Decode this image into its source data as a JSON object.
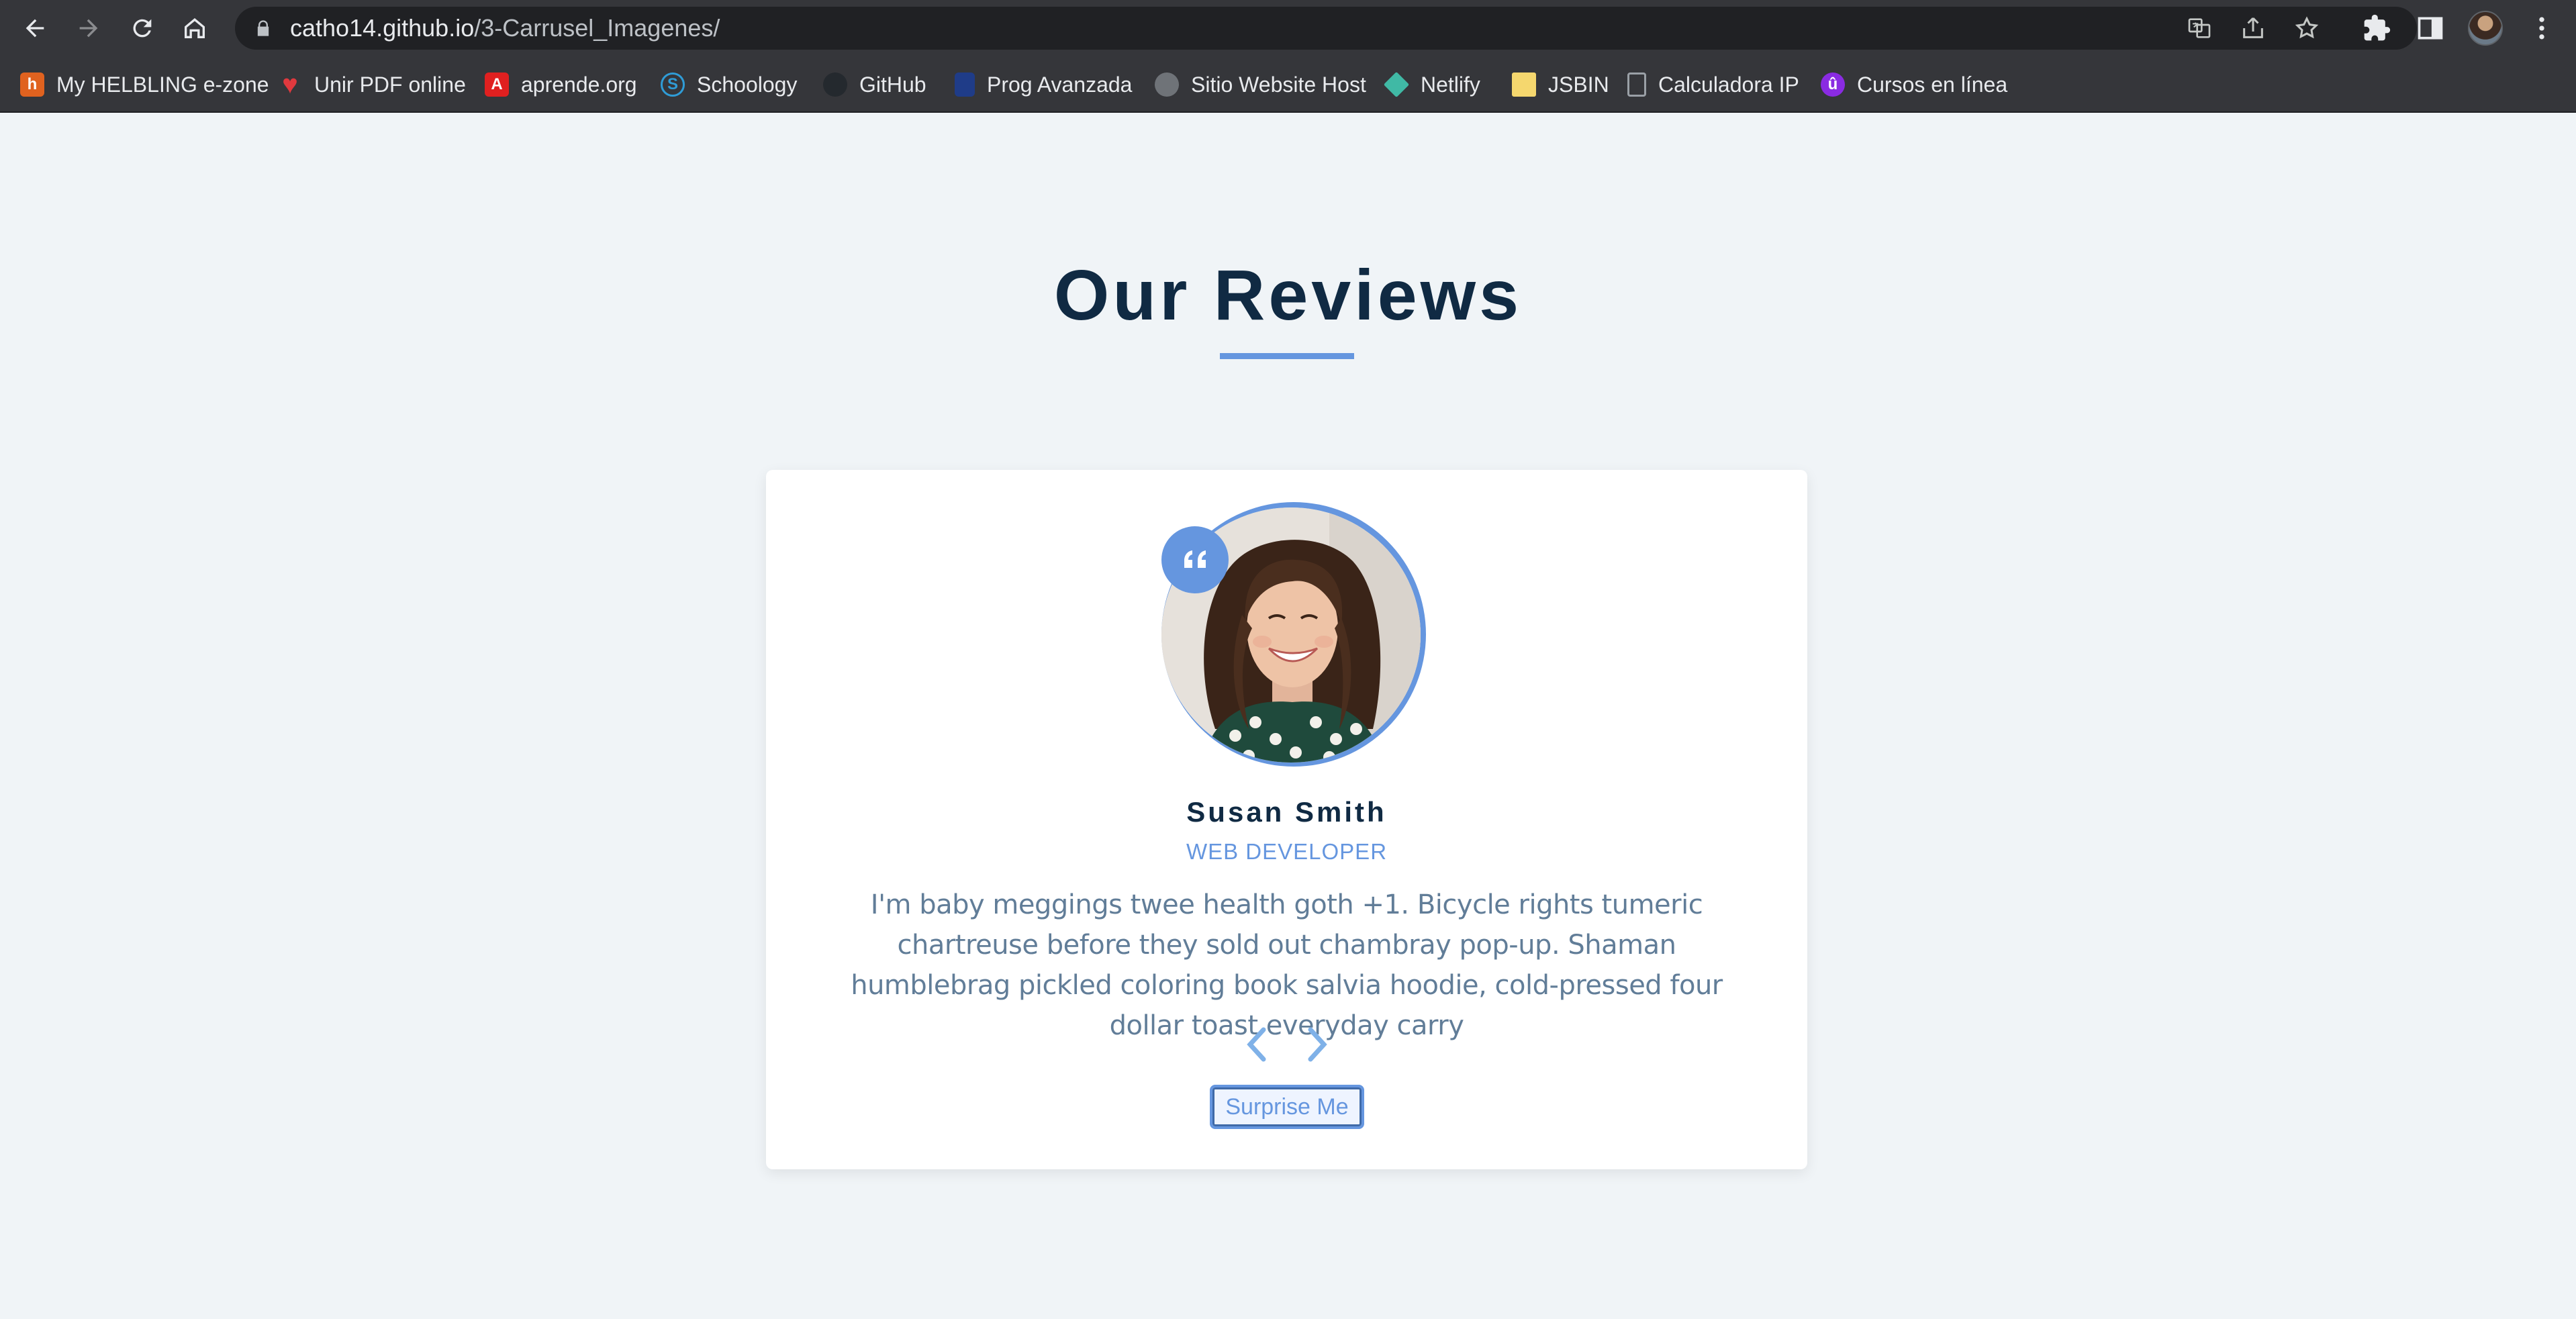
{
  "browser": {
    "url_host": "catho14.github.io",
    "url_path": "/3-Carrusel_Imagenes/"
  },
  "bookmarks": [
    {
      "label": "My HELBLING e-zone",
      "icon": "helbling-icon",
      "color": "#e0621f"
    },
    {
      "label": "Unir PDF online",
      "icon": "heart-icon",
      "color": "#e0393e"
    },
    {
      "label": "aprende.org",
      "icon": "aprende-icon",
      "color": "#e02020"
    },
    {
      "label": "Schoology",
      "icon": "schoology-icon",
      "color": "#2f9cd6"
    },
    {
      "label": "GitHub",
      "icon": "github-icon",
      "color": "#24292e"
    },
    {
      "label": "Prog Avanzada",
      "icon": "prog-icon",
      "color": "#1f3c88"
    },
    {
      "label": "Sitio Website Host",
      "icon": "globe-icon",
      "color": "#6f7378"
    },
    {
      "label": "Netlify",
      "icon": "netlify-icon",
      "color": "#40b9a5"
    },
    {
      "label": "JSBIN",
      "icon": "jsbin-icon",
      "color": "#f5d76e"
    },
    {
      "label": "Calculadora IP",
      "icon": "calculator-icon",
      "color": "#9aa0a6"
    },
    {
      "label": "Cursos en línea",
      "icon": "cursos-icon",
      "color": "#8a2be2"
    }
  ],
  "page": {
    "title": "Our Reviews"
  },
  "review": {
    "author": "Susan Smith",
    "job": "web developer",
    "text": "I'm baby meggings twee health goth +1. Bicycle rights tumeric chartreuse before they sold out chambray pop-up. Shaman humblebrag pickled coloring book salvia hoodie, cold-pressed four dollar toast everyday carry",
    "button_label": "Surprise Me"
  },
  "colors": {
    "accent": "#6596df",
    "heading": "#102a43",
    "body_text": "#617d98",
    "background": "#f0f4f7"
  }
}
